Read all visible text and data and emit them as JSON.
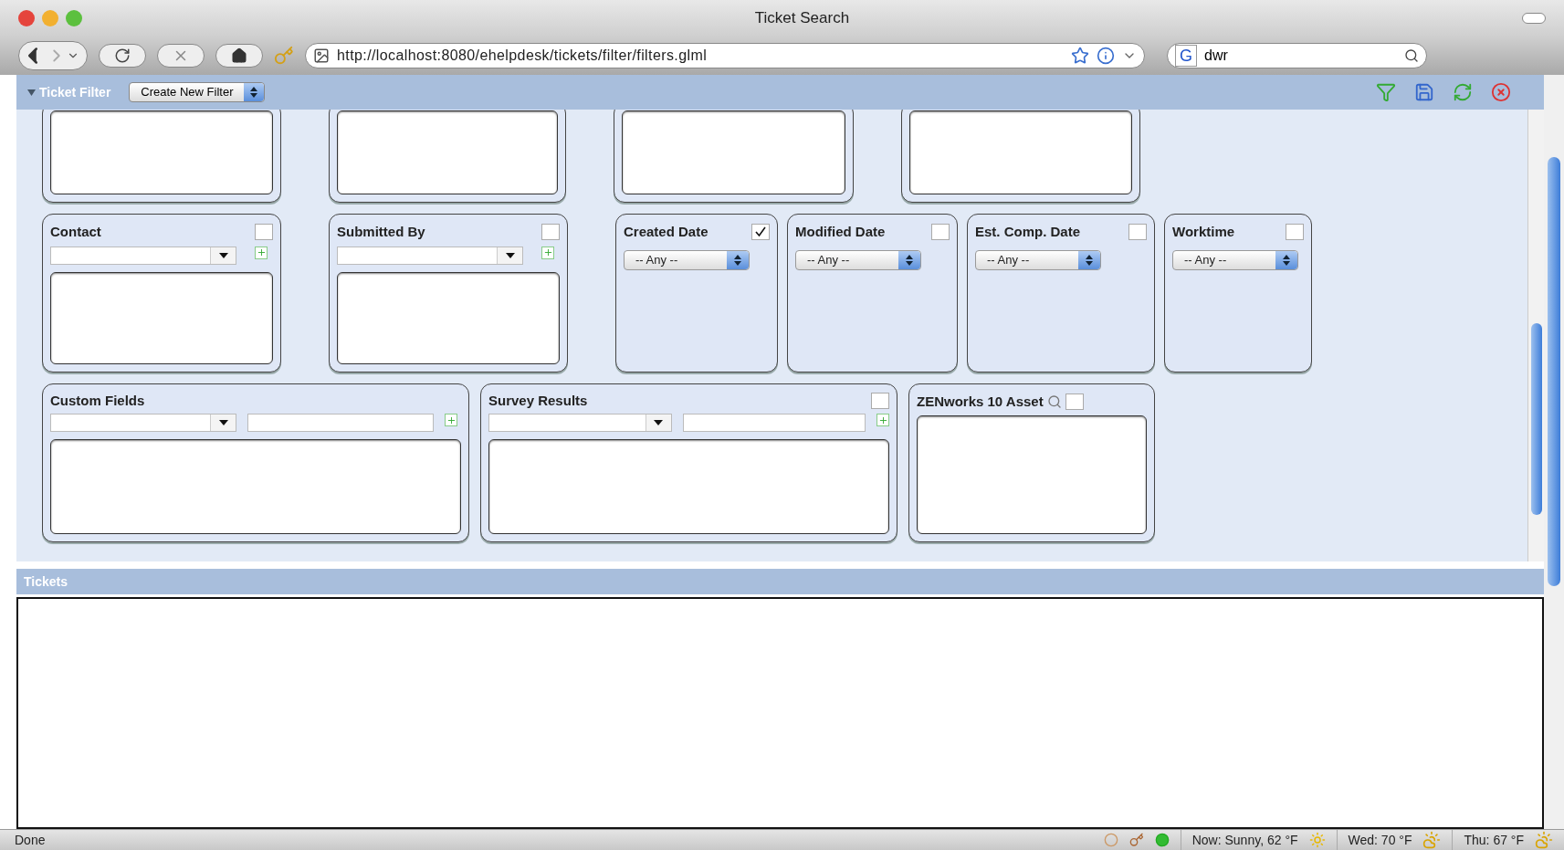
{
  "window": {
    "title": "Ticket Search"
  },
  "toolbar": {
    "url": "http://localhost:8080/ehelpdesk/tickets/filter/filters.glml",
    "search_engine": "G",
    "search_value": "dwr"
  },
  "filter_bar": {
    "title": "Ticket Filter",
    "expanded": true,
    "filter_select": "Create New Filter"
  },
  "top_panels": [
    {
      "kind": "listbox"
    },
    {
      "kind": "listbox"
    },
    {
      "kind": "listbox"
    },
    {
      "kind": "listbox"
    }
  ],
  "middle_panels": [
    {
      "kind": "picker",
      "label": "Contact",
      "checked": false
    },
    {
      "kind": "picker",
      "label": "Submitted By",
      "checked": false
    },
    {
      "kind": "date",
      "label": "Created Date",
      "checked": true,
      "value": "-- Any --"
    },
    {
      "kind": "date",
      "label": "Modified Date",
      "checked": false,
      "value": "-- Any --"
    },
    {
      "kind": "date",
      "label": "Est. Comp. Date",
      "checked": false,
      "value": "-- Any --"
    },
    {
      "kind": "date",
      "label": "Worktime",
      "checked": false,
      "value": "-- Any --"
    }
  ],
  "bottom_panels": [
    {
      "kind": "fields",
      "label": "Custom Fields"
    },
    {
      "kind": "fields",
      "label": "Survey Results",
      "checked": false
    },
    {
      "kind": "asset",
      "label": "ZENworks 10 Asset",
      "checked": false
    }
  ],
  "tickets": {
    "title": "Tickets"
  },
  "status_bar": {
    "status": "Done",
    "weather": [
      "Now: Sunny, 62 °F",
      "Wed: 70 °F",
      "Thu: 67 °F"
    ]
  }
}
